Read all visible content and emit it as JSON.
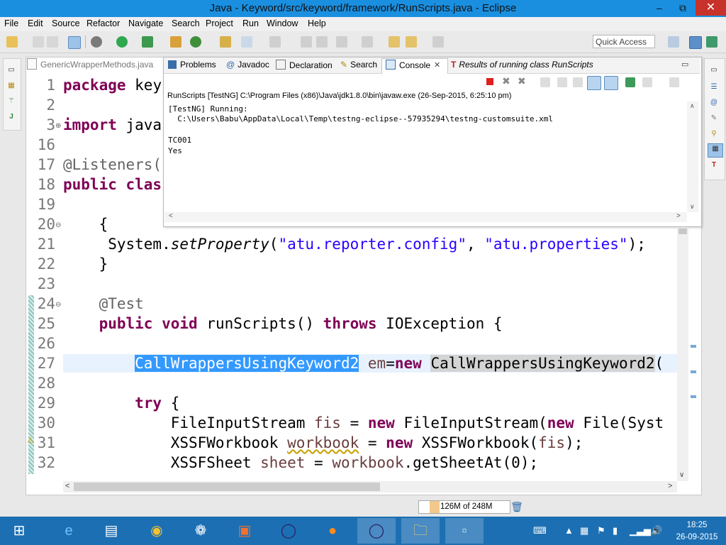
{
  "window": {
    "title": "Java - Keyword/src/keyword/framework/RunScripts.java - Eclipse",
    "min": "–",
    "max": "⧉",
    "close": "✕"
  },
  "menu": [
    "File",
    "Edit",
    "Source",
    "Refactor",
    "Navigate",
    "Search",
    "Project",
    "Run",
    "Window",
    "Help"
  ],
  "quick_access": "Quick Access",
  "editor_tab": "GenericWrapperMethods.java",
  "console_tabs": {
    "problems": "Problems",
    "javadoc": "Javadoc",
    "declaration": "Declaration",
    "search": "Search",
    "console": "Console",
    "results": "Results of running class RunScripts"
  },
  "console": {
    "header": "RunScripts [TestNG] C:\\Program Files (x86)\\Java\\jdk1.8.0\\bin\\javaw.exe (26-Sep-2015, 6:25:10 pm)",
    "lines": [
      "[TestNG] Running:",
      "  C:\\Users\\Babu\\AppData\\Local\\Temp\\testng-eclipse--57935294\\testng-customsuite.xml",
      "",
      "TC001",
      "Yes"
    ]
  },
  "code": {
    "line_numbers": [
      "1",
      "2",
      "3",
      "16",
      "17",
      "18",
      "19",
      "20",
      "21",
      "22",
      "23",
      "24",
      "25",
      "26",
      "27",
      "28",
      "29",
      "30",
      "31",
      "32"
    ],
    "l1_kw": "package",
    "l1_rest": " key",
    "l3_kw": "import",
    "l3_rest": " java",
    "l17": "@Listeners(",
    "l18_kw": "public clas",
    "l20": "    {",
    "l21_a": "     System.",
    "l21_method": "setProperty",
    "l21_b": "(",
    "l21_s1": "\"atu.reporter.config\"",
    "l21_c": ", ",
    "l21_s2": "\"atu.properties\"",
    "l21_d": ");",
    "l22": "    }",
    "l24": "    @Test",
    "l25_kw1": "    public",
    "l25_kw2": " void",
    "l25_a": " runScripts() ",
    "l25_kw3": "throws",
    "l25_b": " IOException {",
    "l27_indent": "        ",
    "l27_sel": "CallWrappersUsingKeyword2",
    "l27_sp": " ",
    "l27_var": "em",
    "l27_eq": "=",
    "l27_kw": "new",
    "l27_sp2": " ",
    "l27_occ": "CallWrappersUsingKeyword2",
    "l27_end": "(",
    "l29_kw": "        try",
    "l29_rest": " {",
    "l30_a": "            FileInputStream ",
    "l30_var": "fis",
    "l30_b": " = ",
    "l30_kw": "new",
    "l30_c": " FileInputStream(",
    "l30_kw2": "new",
    "l30_d": " File(Syst",
    "l31_a": "            XSSFWorkbook ",
    "l31_var": "workbook",
    "l31_b": " = ",
    "l31_kw": "new",
    "l31_c": " XSSFWorkbook(",
    "l31_var2": "fis",
    "l31_d": ");",
    "l32_a": "            XSSFSheet ",
    "l32_var": "sheet",
    "l32_b": " = ",
    "l32_var2": "workbook",
    "l32_c": ".getSheetAt(0);"
  },
  "status": {
    "heap": "126M of 248M",
    "heap_used_fraction": 0.51
  },
  "taskbar": {
    "time": "18:25",
    "date": "26-09-2015"
  }
}
